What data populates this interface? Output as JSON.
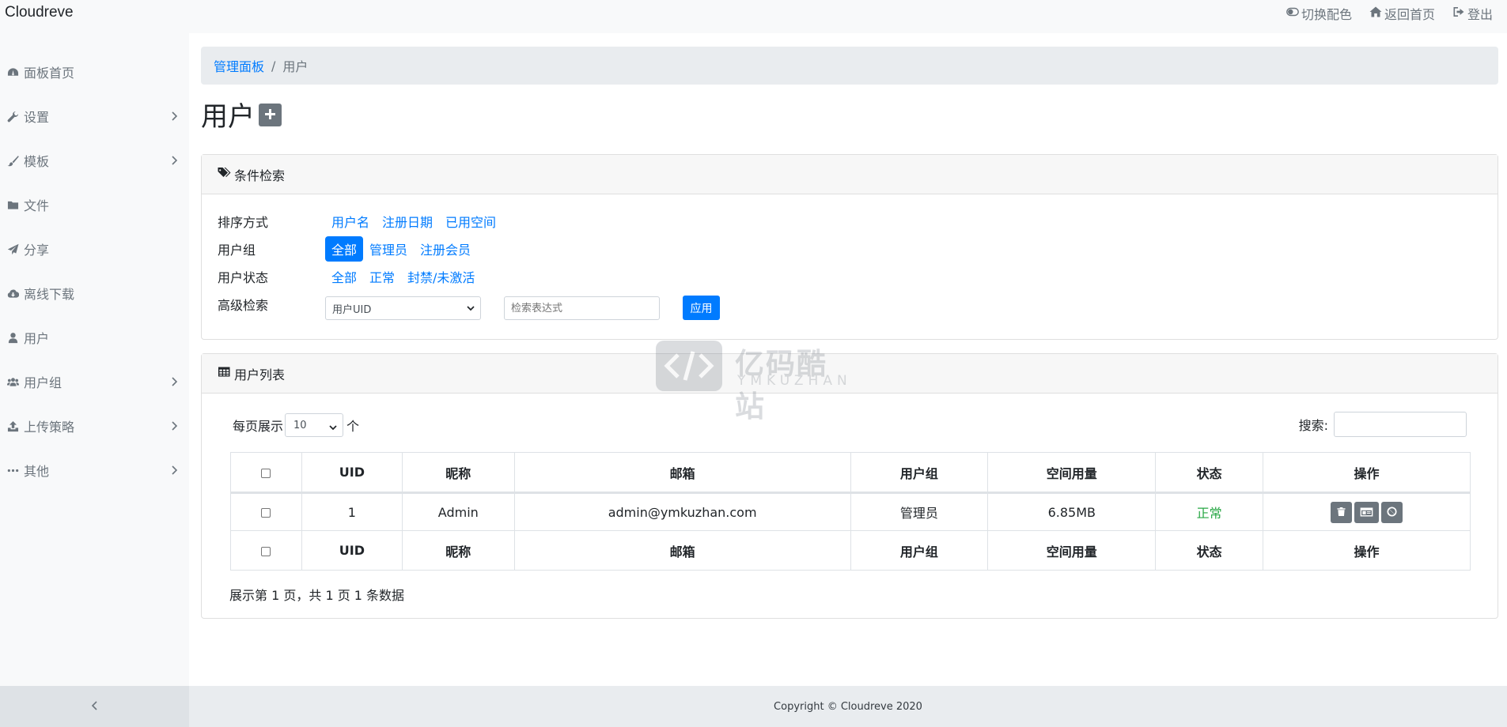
{
  "app": {
    "brand": "Cloudreve"
  },
  "topnav": [
    {
      "label": "切换配色",
      "icon": "toggle-icon"
    },
    {
      "label": "返回首页",
      "icon": "home-icon"
    },
    {
      "label": "登出",
      "icon": "sign-out-icon"
    }
  ],
  "sidebar": {
    "items": [
      {
        "label": "面板首页",
        "icon": "dashboard-icon",
        "has_submenu": false
      },
      {
        "label": "设置",
        "icon": "wrench-icon",
        "has_submenu": true
      },
      {
        "label": "模板",
        "icon": "brush-icon",
        "has_submenu": true
      },
      {
        "label": "文件",
        "icon": "folder-icon",
        "has_submenu": false
      },
      {
        "label": "分享",
        "icon": "paper-plane-icon",
        "has_submenu": false
      },
      {
        "label": "离线下载",
        "icon": "cloud-download-icon",
        "has_submenu": false
      },
      {
        "label": "用户",
        "icon": "user-icon",
        "has_submenu": false
      },
      {
        "label": "用户组",
        "icon": "users-icon",
        "has_submenu": true
      },
      {
        "label": "上传策略",
        "icon": "upload-icon",
        "has_submenu": true
      },
      {
        "label": "其他",
        "icon": "ellipsis-icon",
        "has_submenu": true
      }
    ]
  },
  "breadcrumb": {
    "root": "管理面板",
    "separator": "/",
    "current": "用户"
  },
  "page": {
    "title": "用户"
  },
  "filter_card": {
    "title": "条件检索",
    "sort": {
      "label": "排序方式",
      "options": [
        "用户名",
        "注册日期",
        "已用空间"
      ]
    },
    "group": {
      "label": "用户组",
      "options": [
        "全部",
        "管理员",
        "注册会员"
      ],
      "active": "全部"
    },
    "status": {
      "label": "用户状态",
      "options": [
        "全部",
        "正常",
        "封禁/未激活"
      ]
    },
    "advanced": {
      "label": "高级检索",
      "select_value": "用户UID",
      "input_placeholder": "检索表达式",
      "apply_label": "应用"
    }
  },
  "list_card": {
    "title": "用户列表",
    "page_size_prefix": "每页展示",
    "page_size_value": "10",
    "page_size_suffix": "个",
    "search_label": "搜索:",
    "columns": [
      "UID",
      "昵称",
      "邮箱",
      "用户组",
      "空间用量",
      "状态",
      "操作"
    ],
    "rows": [
      {
        "uid": "1",
        "nickname": "Admin",
        "email": "admin@ymkuzhan.com",
        "group": "管理员",
        "usage": "6.85MB",
        "status": "正常"
      }
    ],
    "summary": "展示第 1 页，共 1 页 1 条数据"
  },
  "watermark": {
    "cn": "亿码酷站",
    "en": "YMKUZHAN"
  },
  "footer": {
    "copyright": "Copyright © Cloudreve 2020"
  },
  "colors": {
    "accent": "#007bff",
    "success": "#28a745",
    "muted": "#6c757d",
    "sidebar_bg": "#f8f9fa"
  }
}
